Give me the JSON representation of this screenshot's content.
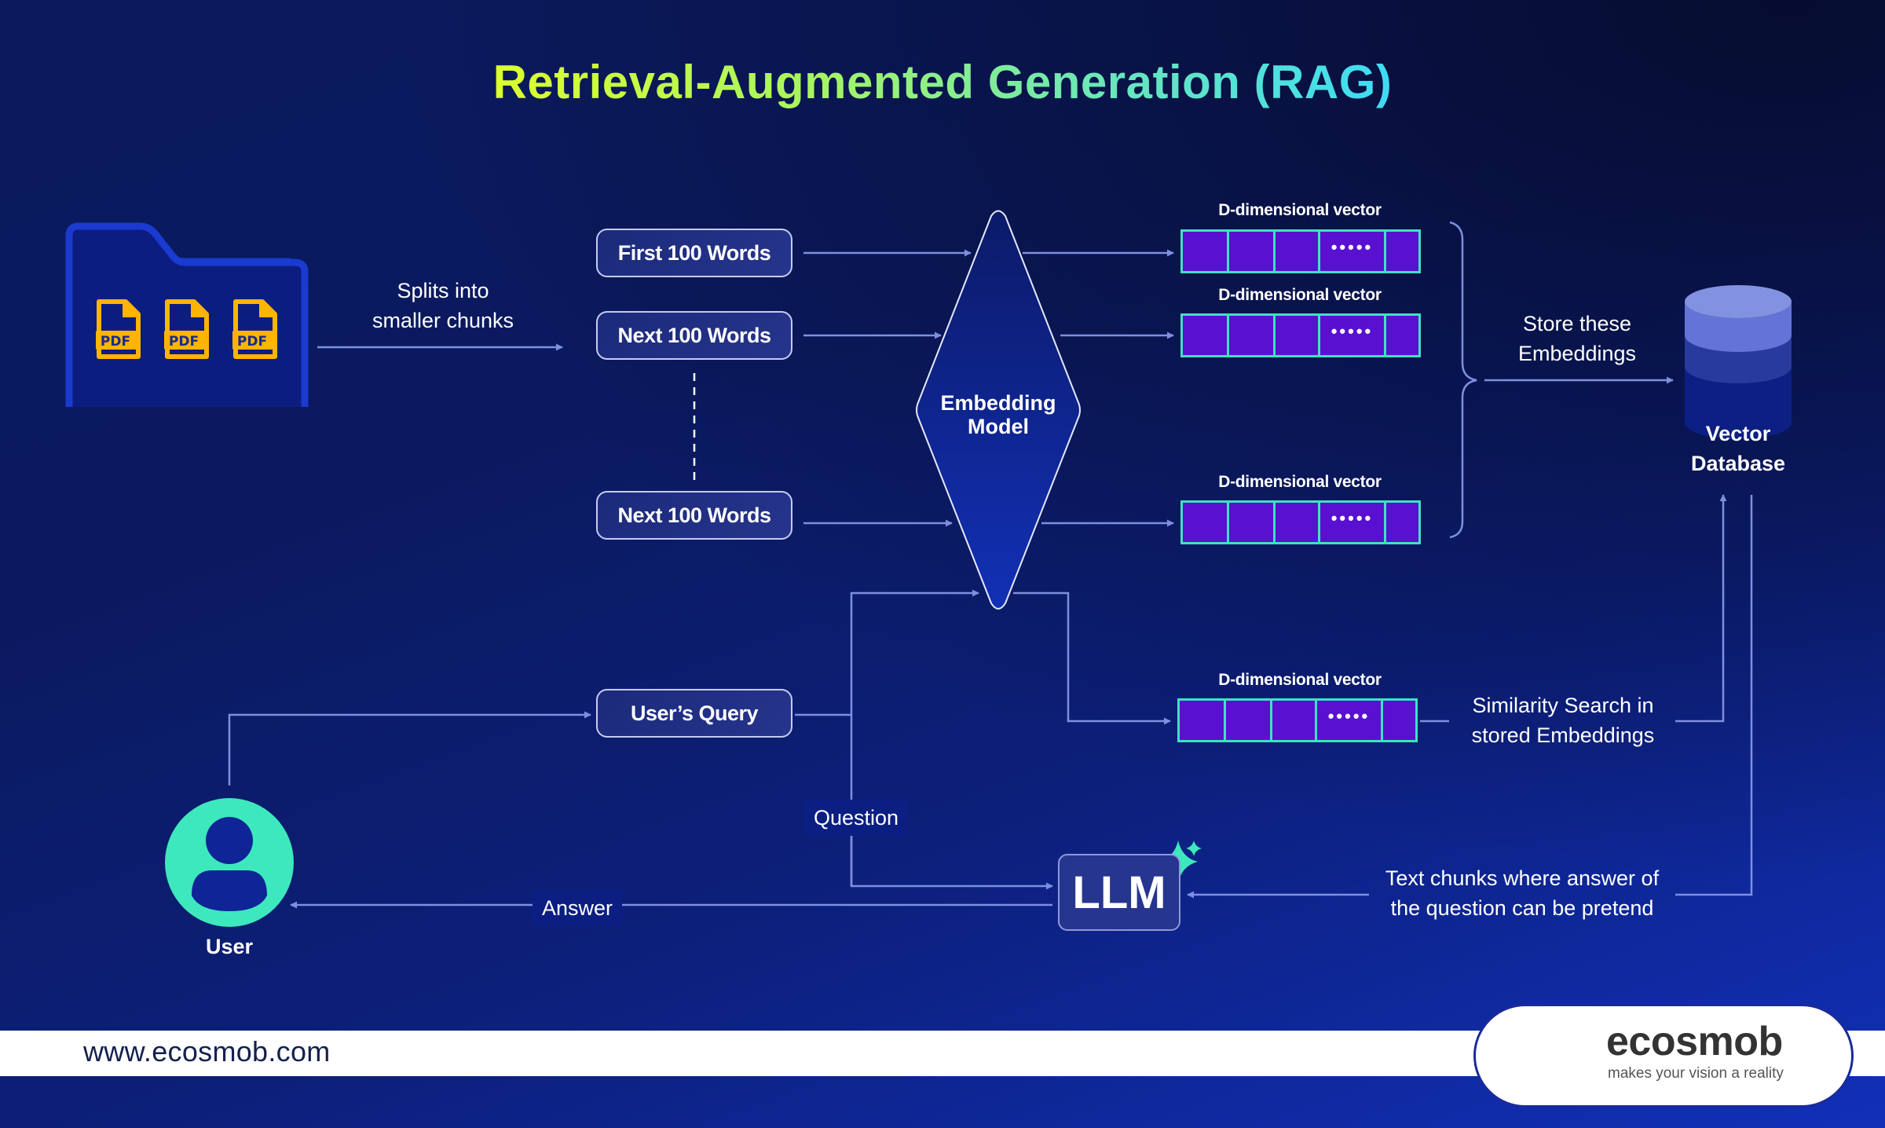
{
  "title": "Retrieval-Augmented Generation (RAG)",
  "colors": {
    "background": "#0b1a60",
    "title_gradient_start": "#dcff2e",
    "title_gradient_end": "#3ddcf5",
    "connector": "#7f8fe0",
    "vector_fill": "#5a10d0",
    "vector_border": "#3de3c0",
    "user_icon": "#3de8bd",
    "pdf_icon": "#ffb400",
    "folder_outline": "#1a3ad0",
    "sparkle": "#3de8bd"
  },
  "source": {
    "folder_icon": "folder-icon",
    "files": [
      {
        "icon": "pdf-file-icon",
        "label": "PDF"
      },
      {
        "icon": "pdf-file-icon",
        "label": "PDF"
      },
      {
        "icon": "pdf-file-icon",
        "label": "PDF"
      }
    ],
    "split_label_line1": "Splits into",
    "split_label_line2": "smaller chunks"
  },
  "chunks": [
    {
      "label": "First 100 Words"
    },
    {
      "label": "Next 100 Words"
    },
    {
      "label": "Next 100 Words"
    }
  ],
  "embedding_model": {
    "line1": "Embedding",
    "line2": "Model"
  },
  "vectors": [
    {
      "label": "D-dimensional vector",
      "ellipsis": "•••••"
    },
    {
      "label": "D-dimensional vector",
      "ellipsis": "•••••"
    },
    {
      "label": "D-dimensional vector",
      "ellipsis": "•••••"
    },
    {
      "label": "D-dimensional vector",
      "ellipsis": "•••••"
    }
  ],
  "store": {
    "line1": "Store these",
    "line2": "Embeddings"
  },
  "vector_db": {
    "icon": "database-icon",
    "line1": "Vector",
    "line2": "Database"
  },
  "similarity": {
    "line1": "Similarity Search in",
    "line2": "stored Embeddings"
  },
  "retrieved": {
    "line1": "Text chunks where answer of",
    "line2": "the question can be pretend"
  },
  "query": {
    "label": "User’s Query"
  },
  "question_label": "Question",
  "answer_label": "Answer",
  "llm": {
    "label": "LLM",
    "icon": "sparkle-icon"
  },
  "user": {
    "icon": "user-icon",
    "label": "User"
  },
  "footer": {
    "url": "www.ecosmob.com",
    "brand": "ecosmob",
    "tagline": "makes your vision a reality",
    "logo_icon": "ecosmob-logo-icon"
  }
}
